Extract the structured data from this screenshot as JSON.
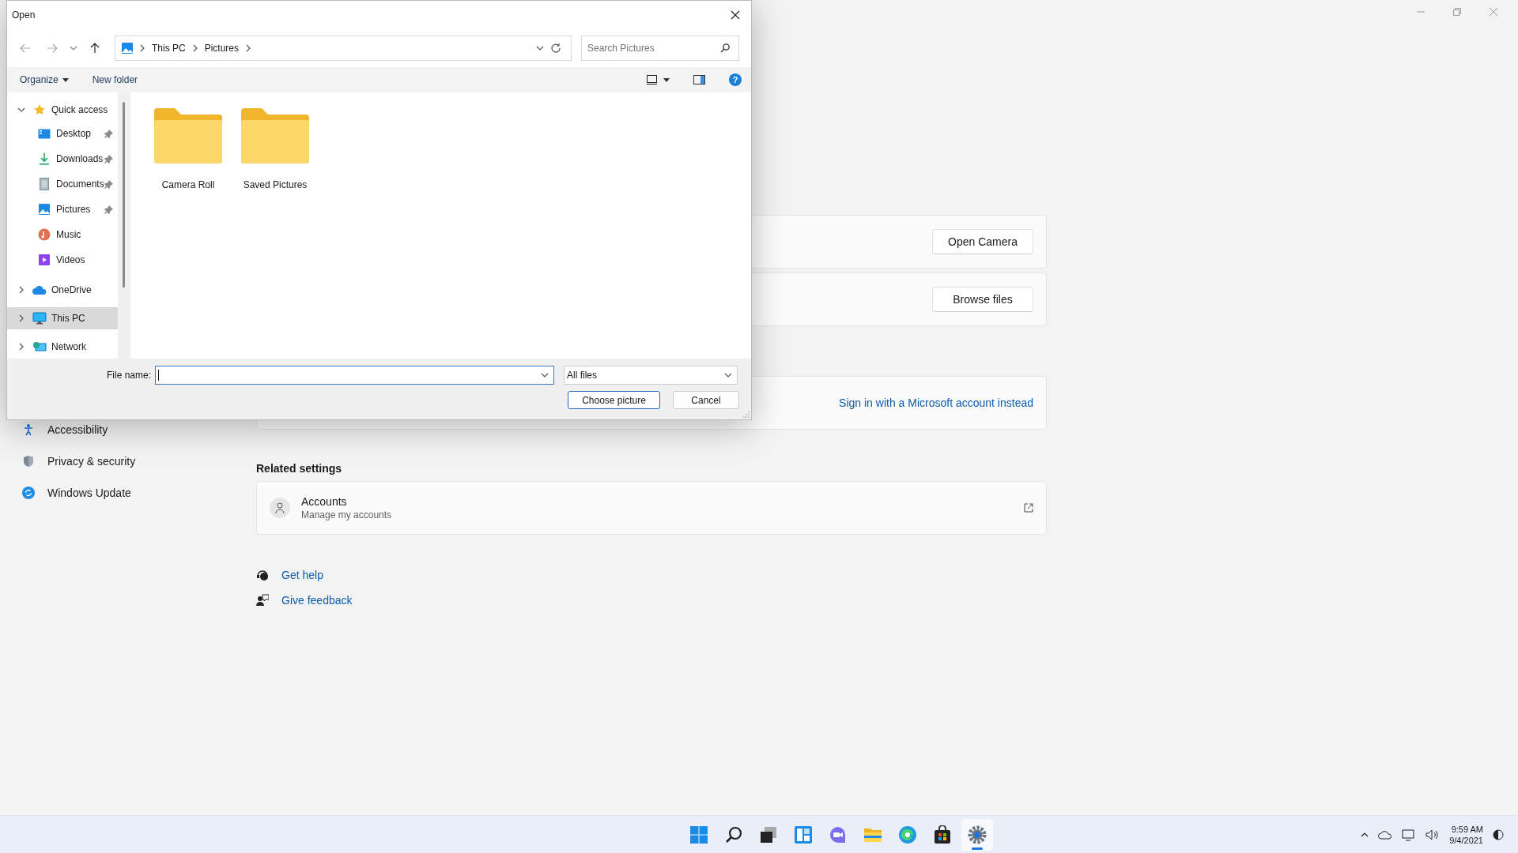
{
  "dialog": {
    "title": "Open",
    "back": {
      "disabled": true
    },
    "forward": {
      "disabled": true
    },
    "breadcrumb": [
      "This PC",
      "Pictures"
    ],
    "search": {
      "placeholder": "Search Pictures"
    },
    "commands": [
      "Organize",
      "New folder"
    ],
    "help": "?",
    "sidebar": [
      {
        "label": "Quick access",
        "expanded": true,
        "selected": false,
        "children": [
          {
            "label": "Desktop",
            "pinned": true,
            "selected": false
          },
          {
            "label": "Downloads",
            "pinned": true,
            "selected": false
          },
          {
            "label": "Documents",
            "pinned": true,
            "selected": false
          },
          {
            "label": "Pictures",
            "pinned": true,
            "selected": false
          },
          {
            "label": "Music",
            "pinned": false,
            "selected": false
          },
          {
            "label": "Videos",
            "pinned": false,
            "selected": false
          }
        ]
      },
      {
        "label": "OneDrive",
        "expanded": false,
        "selected": false
      },
      {
        "label": "This PC",
        "expanded": false,
        "selected": true
      },
      {
        "label": "Network",
        "expanded": false,
        "selected": false
      }
    ],
    "items": [
      {
        "name": "Camera Roll"
      },
      {
        "name": "Saved Pictures"
      }
    ],
    "file_name": {
      "label": "File name:",
      "focused": true
    },
    "file_type": "All files",
    "buttons": [
      {
        "label": "Choose picture",
        "primary": true
      },
      {
        "label": "Cancel",
        "primary": false
      }
    ]
  },
  "settings": {
    "nav": [
      "Accessibility",
      "Privacy & security",
      "Windows Update"
    ],
    "cards": [
      {
        "kind": "button",
        "text": "Open Camera"
      },
      {
        "kind": "button",
        "text": "Browse files"
      },
      {
        "kind": "link",
        "text": "Sign in with a Microsoft account instead"
      }
    ],
    "related_heading": "Related settings",
    "related": [
      {
        "title": "Accounts",
        "subtitle": "Manage my accounts"
      }
    ],
    "help_links": [
      "Get help",
      "Give feedback"
    ]
  },
  "taskbar": {
    "apps": [
      {
        "selected": false
      },
      {
        "selected": false
      },
      {
        "selected": false
      },
      {
        "selected": false
      },
      {
        "selected": false
      },
      {
        "selected": false
      },
      {
        "selected": false
      },
      {
        "selected": false
      },
      {
        "selected": true
      }
    ],
    "clock": {
      "time": "9:59 AM",
      "date": "9/4/2021"
    }
  }
}
